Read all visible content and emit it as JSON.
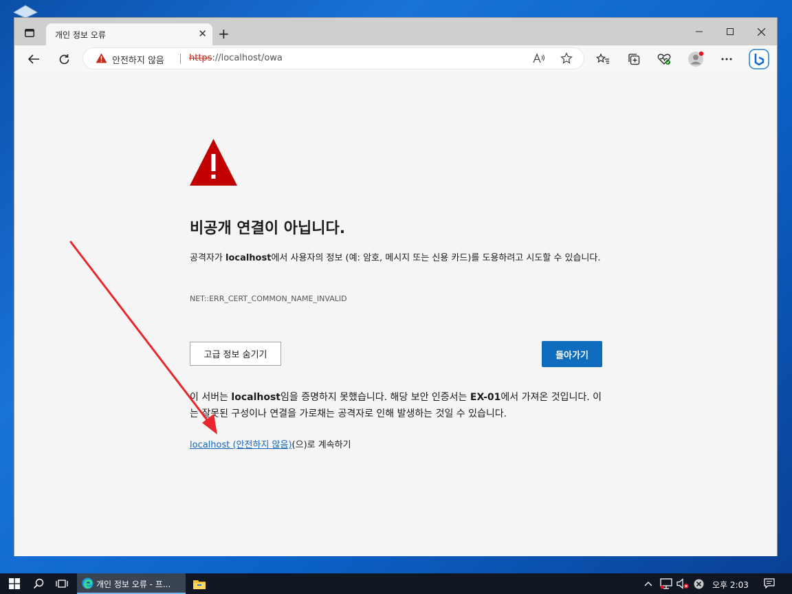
{
  "browser": {
    "tab_title": "개인 정보 오류",
    "address_warning": "안전하지 않음",
    "url_scheme": "https",
    "url_rest": "://localhost/owa"
  },
  "page": {
    "heading": "비공개 연결이 아닙니다.",
    "desc_pre": "공격자가 ",
    "desc_host": "localhost",
    "desc_post": "에서 사용자의 정보 (예: 암호, 메시지 또는 신용 카드)를 도용하려고 시도할 수 있습니다.",
    "error_code": "NET::ERR_CERT_COMMON_NAME_INVALID",
    "advanced_button": "고급 정보 숨기기",
    "back_button": "돌아가기",
    "adv_pre": "이 서버는 ",
    "adv_host": "localhost",
    "adv_mid": "임을 증명하지 못했습니다. 해당 보안 인증서는 ",
    "adv_issuer": "EX-01",
    "adv_post": "에서 가져온 것입니다. 이는 잘못된 구성이나 연결을 가로채는 공격자로 인해 발생하는 것일 수 있습니다.",
    "proceed_link": "localhost (안전하지 않음)",
    "proceed_suffix": "(으)로 계속하기"
  },
  "taskbar": {
    "app_label": "개인 정보 오류 - 프...",
    "clock": "오후 2:03"
  },
  "colors": {
    "warning_red": "#c00000",
    "accent_blue": "#0f6cbd",
    "annotation_arrow": "#e8262b"
  }
}
